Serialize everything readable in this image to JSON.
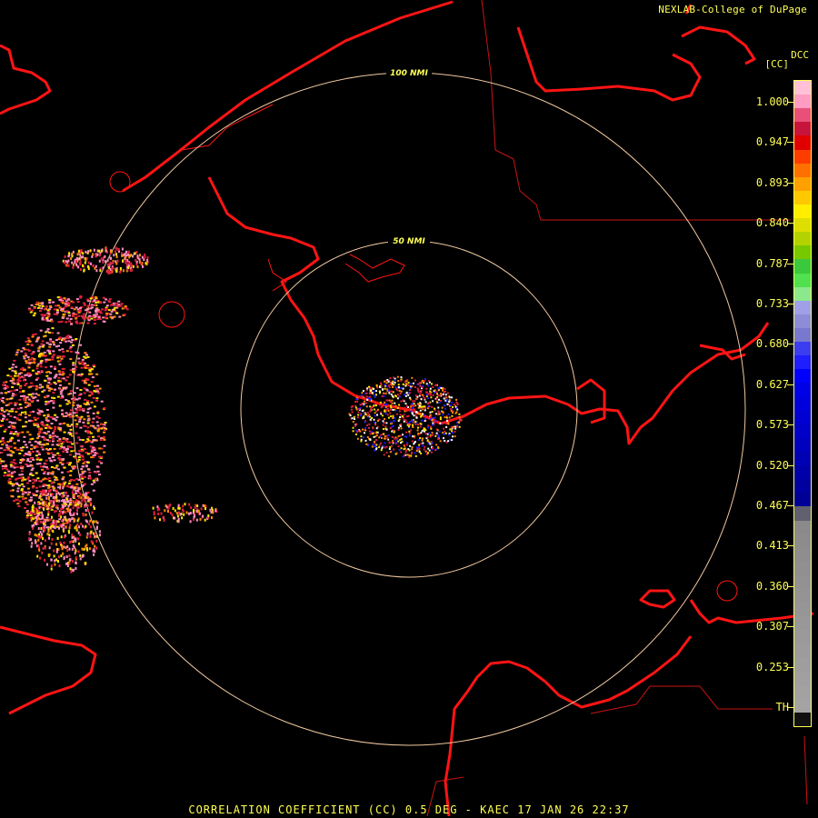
{
  "header": {
    "credit": "NEXLAB-College of DuPage"
  },
  "legend": {
    "product_code": "DCC",
    "units": "[CC]",
    "tick_labels": [
      "1.000",
      "0.947",
      "0.893",
      "0.840",
      "0.787",
      "0.733",
      "0.680",
      "0.627",
      "0.573",
      "0.520",
      "0.467",
      "0.413",
      "0.360",
      "0.307",
      "0.253",
      "TH"
    ],
    "colors": [
      "#ffc0d8",
      "#ff9cc4",
      "#e8507a",
      "#c8143c",
      "#e00000",
      "#ff3c00",
      "#ff7000",
      "#ffa000",
      "#ffc800",
      "#ffee00",
      "#dede00",
      "#b4d200",
      "#78c800",
      "#3cc83c",
      "#50e050",
      "#8ce88c",
      "#a0a0e8",
      "#8c8cd8",
      "#7878d0",
      "#3c3cf0",
      "#1e1eff",
      "#0000ff",
      "#0000e6",
      "#0000dc",
      "#0000d2",
      "#0000c8",
      "#0000be",
      "#0000b4",
      "#0000aa",
      "#0000a0",
      "#000096",
      "#606070",
      "#8a8a8a",
      "#8c8c8c",
      "#8e8e8e",
      "#909090",
      "#929292",
      "#949494",
      "#969696",
      "#989898",
      "#9a9a9a",
      "#9c9c9c",
      "#9e9e9e",
      "#a0a0a0",
      "#a2a2a2",
      "#a4a4a4",
      "#101010"
    ]
  },
  "map": {
    "range_rings": [
      {
        "label": "100 NMI",
        "range_nmi": 100
      },
      {
        "label": "50 NMI",
        "range_nmi": 50
      }
    ],
    "colors": {
      "coastline": "#ff1414",
      "boundary": "#dc1414",
      "ring": "#f0c8a0",
      "echo_pink": "#ff8cc0",
      "echo_red": "#e0203c",
      "echo_orange": "#ff8c00",
      "echo_yellow": "#ffe600"
    }
  },
  "footer": {
    "product_line": "CORRELATION COEFFICIENT (CC) 0.5 DEG - KAEC 17 JAN 26 22:37"
  }
}
